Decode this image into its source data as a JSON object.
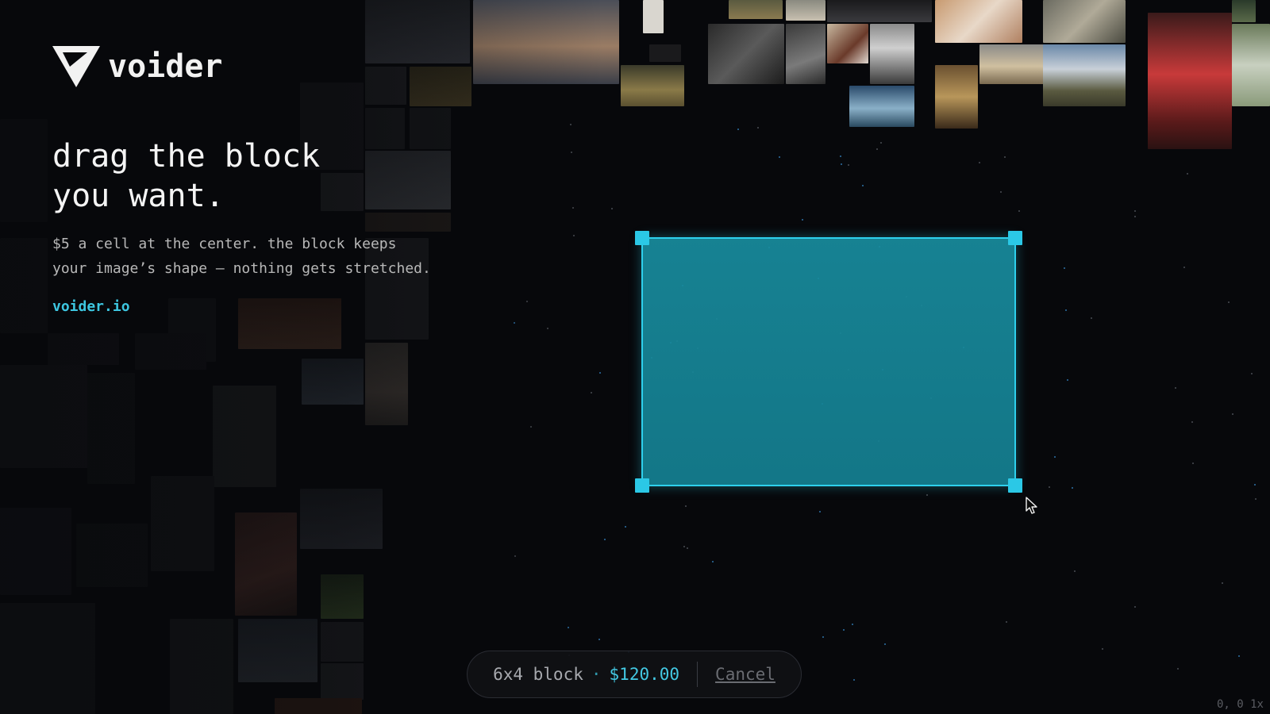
{
  "brand": {
    "name": "voider"
  },
  "hero": {
    "headline_lines": [
      "drag the block",
      "you want."
    ],
    "subtext_lines": [
      "$5 a cell at the center. the block keeps",
      "your image’s shape — nothing gets stretched."
    ],
    "link_text": "voider.io"
  },
  "order_bar": {
    "block_size": "6x4 block",
    "separator": "·",
    "price": "$120.00",
    "cancel_label": "Cancel"
  },
  "status": {
    "coordinates": "0, 0 1x"
  },
  "colors": {
    "accent": "#2ed0ec",
    "selection_fill": "#188c9e",
    "background": "#07080b",
    "price": "#43c9e3"
  },
  "icons": {
    "logo": "voider-triangle-logo",
    "cursor": "arrow-cursor-icon"
  }
}
